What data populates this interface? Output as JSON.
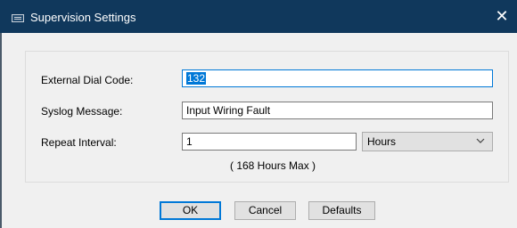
{
  "window": {
    "title": "Supervision Settings",
    "close_glyph": "✕"
  },
  "form": {
    "external_dial_code": {
      "label": "External Dial Code:",
      "value": "132"
    },
    "syslog_message": {
      "label": "Syslog Message:",
      "value": "Input Wiring Fault"
    },
    "repeat_interval": {
      "label": "Repeat Interval:",
      "value": "1",
      "unit_selected": "Hours",
      "max_note": "( 168 Hours Max )"
    }
  },
  "buttons": {
    "ok": "OK",
    "cancel": "Cancel",
    "defaults": "Defaults"
  },
  "colors": {
    "titlebar": "#10385c",
    "focus_accent": "#0078d7",
    "dialog_bg": "#f0f0f0"
  },
  "icons": {
    "window": "window-icon",
    "close": "close-icon",
    "dropdown": "chevron-down-icon"
  }
}
